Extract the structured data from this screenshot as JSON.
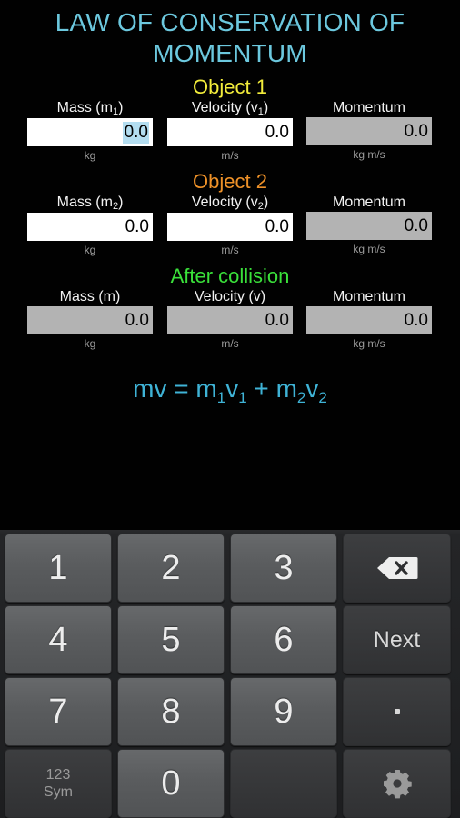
{
  "app": {
    "title": "LAW OF CONSERVATION OF MOMENTUM",
    "title_line1": "LAW OF CONSERVATION OF",
    "title_line2": "MOMENTUM",
    "title_color": "#6cc8de",
    "background": "#000000"
  },
  "sections": [
    {
      "heading": "Object 1",
      "heading_color": "#f2ec3b",
      "fields": [
        {
          "label_text": "Mass (m",
          "label_sub": "1",
          "label_tail": ")",
          "value": "0.0",
          "unit": "kg",
          "readonly": false,
          "selected": true
        },
        {
          "label_text": "Velocity (v",
          "label_sub": "1",
          "label_tail": ")",
          "value": "0.0",
          "unit": "m/s",
          "readonly": false,
          "selected": false
        },
        {
          "label_text": "Momentum",
          "label_sub": "",
          "label_tail": "",
          "value": "0.0",
          "unit": "kg m/s",
          "readonly": true,
          "selected": false
        }
      ]
    },
    {
      "heading": "Object 2",
      "heading_color": "#ee9128",
      "fields": [
        {
          "label_text": "Mass (m",
          "label_sub": "2",
          "label_tail": ")",
          "value": "0.0",
          "unit": "kg",
          "readonly": false,
          "selected": false
        },
        {
          "label_text": "Velocity (v",
          "label_sub": "2",
          "label_tail": ")",
          "value": "0.0",
          "unit": "m/s",
          "readonly": false,
          "selected": false
        },
        {
          "label_text": "Momentum",
          "label_sub": "",
          "label_tail": "",
          "value": "0.0",
          "unit": "kg m/s",
          "readonly": true,
          "selected": false
        }
      ]
    },
    {
      "heading": "After collision",
      "heading_color": "#3ae03a",
      "fields": [
        {
          "label_text": "Mass (m)",
          "label_sub": "",
          "label_tail": "",
          "value": "0.0",
          "unit": "kg",
          "readonly": true,
          "selected": false
        },
        {
          "label_text": "Velocity (v)",
          "label_sub": "",
          "label_tail": "",
          "value": "0.0",
          "unit": "m/s",
          "readonly": true,
          "selected": false
        },
        {
          "label_text": "Momentum",
          "label_sub": "",
          "label_tail": "",
          "value": "0.0",
          "unit": "kg m/s",
          "readonly": true,
          "selected": false
        }
      ]
    }
  ],
  "formula": {
    "text": "mv = m1v1 + m2v2",
    "color": "#3fb3d6",
    "parts": [
      {
        "base": "mv = m",
        "sub": "1"
      },
      {
        "base": "v",
        "sub": "1"
      },
      {
        "base": " + m",
        "sub": "2"
      },
      {
        "base": "v",
        "sub": "2"
      }
    ]
  },
  "keyboard": {
    "rows": [
      [
        {
          "label": "1",
          "type": "digit",
          "name": "key-1"
        },
        {
          "label": "2",
          "type": "digit",
          "name": "key-2"
        },
        {
          "label": "3",
          "type": "digit",
          "name": "key-3"
        },
        {
          "label": "",
          "type": "backspace",
          "name": "key-backspace",
          "icon": "backspace-icon"
        }
      ],
      [
        {
          "label": "4",
          "type": "digit",
          "name": "key-4"
        },
        {
          "label": "5",
          "type": "digit",
          "name": "key-5"
        },
        {
          "label": "6",
          "type": "digit",
          "name": "key-6"
        },
        {
          "label": "Next",
          "type": "next",
          "name": "key-next"
        }
      ],
      [
        {
          "label": "7",
          "type": "digit",
          "name": "key-7"
        },
        {
          "label": "8",
          "type": "digit",
          "name": "key-8"
        },
        {
          "label": "9",
          "type": "digit",
          "name": "key-9"
        },
        {
          "label": ".",
          "type": "dot",
          "name": "key-period"
        }
      ],
      [
        {
          "label": "123 Sym",
          "label_top": "123",
          "label_bottom": "Sym",
          "type": "sym",
          "name": "key-symbols"
        },
        {
          "label": "0",
          "type": "digit",
          "name": "key-0"
        },
        {
          "label": "",
          "type": "blank",
          "name": "key-space"
        },
        {
          "label": "",
          "type": "settings",
          "name": "key-settings",
          "icon": "gear-icon"
        }
      ]
    ]
  }
}
